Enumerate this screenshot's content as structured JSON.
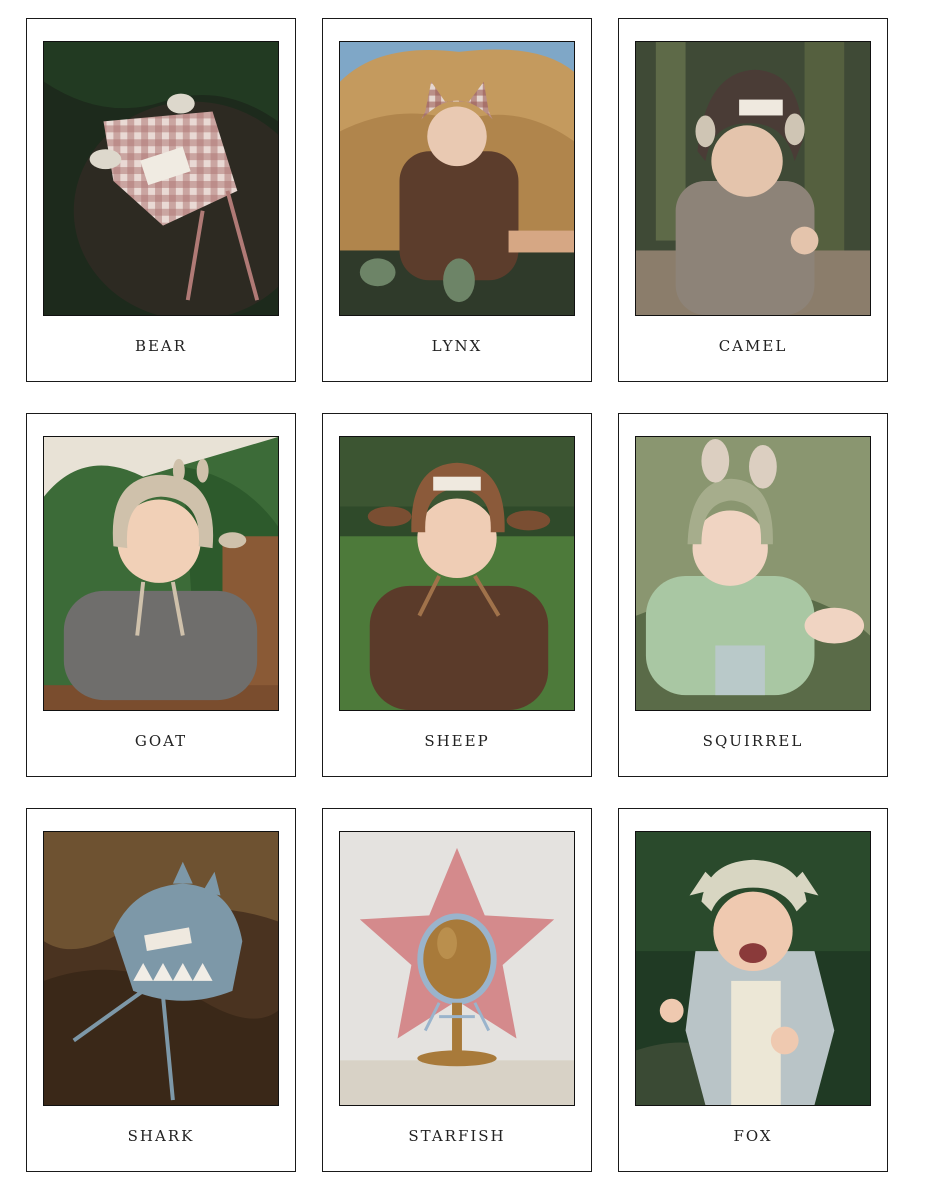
{
  "cards": [
    {
      "label": "BEAR"
    },
    {
      "label": "LYNX"
    },
    {
      "label": "CAMEL"
    },
    {
      "label": "GOAT"
    },
    {
      "label": "SHEEP"
    },
    {
      "label": "SQUIRREL"
    },
    {
      "label": "SHARK"
    },
    {
      "label": "STARFISH"
    },
    {
      "label": "FOX"
    }
  ],
  "colors": {
    "card_border": "#1a1a1a",
    "label_text": "#222222"
  }
}
